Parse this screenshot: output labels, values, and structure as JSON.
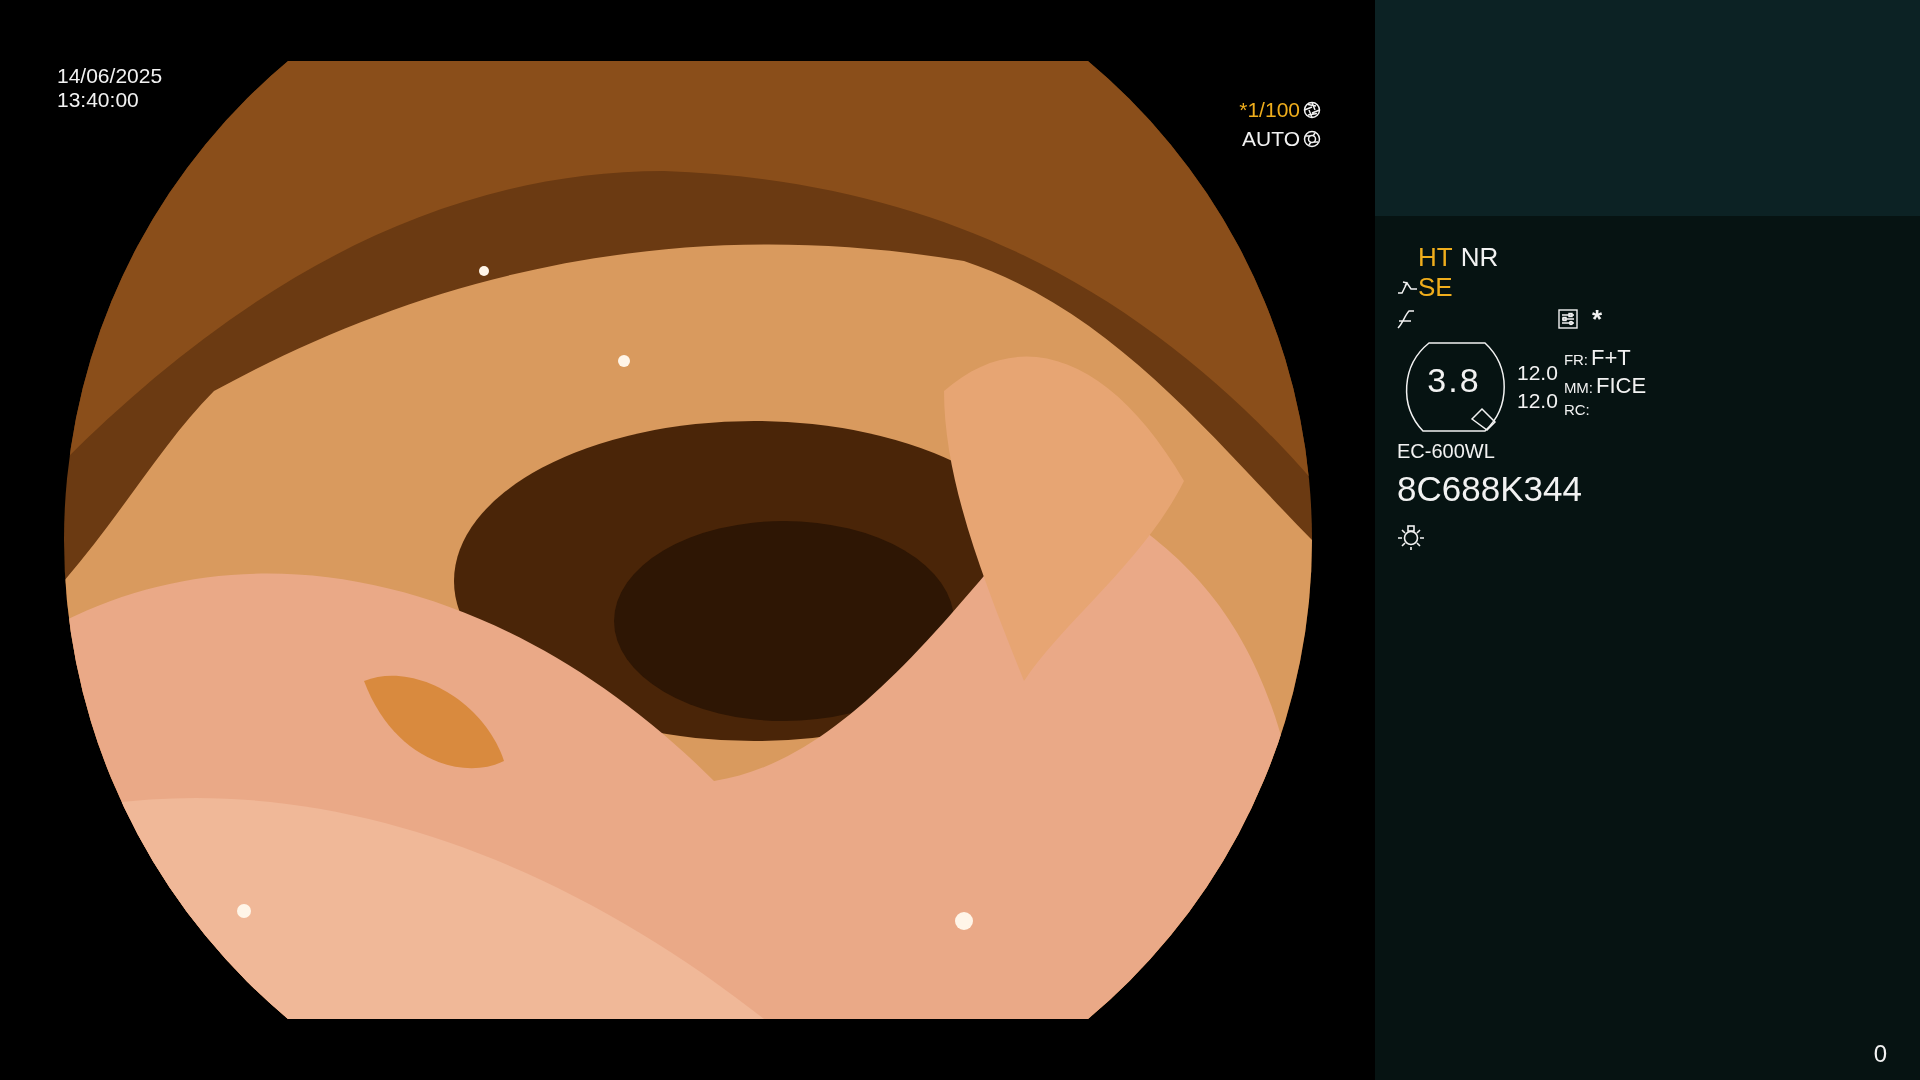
{
  "timestamp": {
    "date": "14/06/2025",
    "time": "13:40:00"
  },
  "shutter": {
    "value": "*1/100",
    "on": true
  },
  "iris": {
    "value": "AUTO"
  },
  "modes": [
    {
      "label": "HT",
      "on": true
    },
    {
      "label": "NR",
      "on": false
    }
  ],
  "enhance": {
    "label": "SE",
    "on": true
  },
  "marker": "*",
  "lens": {
    "value": "3.8",
    "readings": [
      "12.0",
      "12.0"
    ]
  },
  "settings": [
    {
      "key": "FR:",
      "value": "F+T"
    },
    {
      "key": "MM:",
      "value": "FICE"
    },
    {
      "key": "RC:"
    }
  ],
  "scope": {
    "model": "EC-600WL",
    "serial": "8C688K344"
  },
  "counter": "0"
}
